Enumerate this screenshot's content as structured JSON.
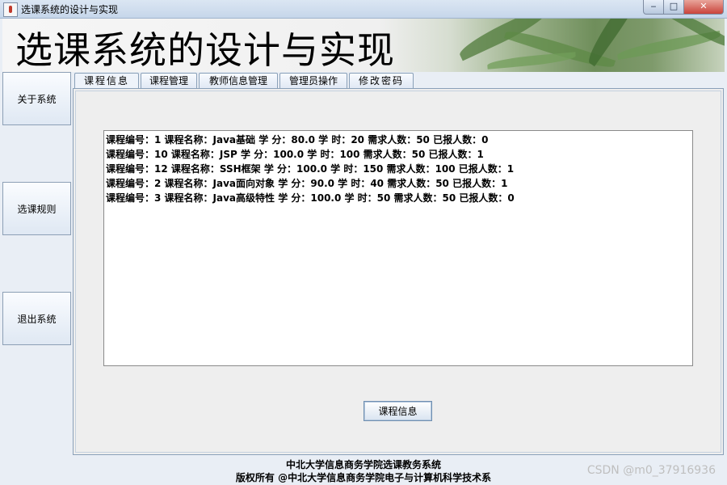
{
  "window": {
    "title": "选课系统的设计与实现",
    "controls": {
      "minimize": "‒",
      "maximize": "□",
      "close": "✕"
    }
  },
  "banner": {
    "title": "选课系统的设计与实现"
  },
  "sidebar": {
    "items": [
      {
        "label": "关于系统"
      },
      {
        "label": "选课规则"
      },
      {
        "label": "退出系统"
      }
    ]
  },
  "tabs": [
    {
      "label": "课程信息",
      "active": true
    },
    {
      "label": "课程管理",
      "active": false
    },
    {
      "label": "教师信息管理",
      "active": false
    },
    {
      "label": "管理员操作",
      "active": false
    },
    {
      "label": "修改密码",
      "active": false
    }
  ],
  "courses": [
    "课程编号：1  课程名称：Java基础  学 分：80.0  学 时：20  需求人数：50  已报人数：0",
    "课程编号：10  课程名称：JSP  学 分：100.0  学 时：100  需求人数：50  已报人数：1",
    "课程编号：12  课程名称：SSH框架  学 分：100.0  学 时：150  需求人数：100  已报人数：1",
    "课程编号：2  课程名称：Java面向对象  学 分：90.0  学 时：40  需求人数：50  已报人数：1",
    "课程编号：3  课程名称：Java高级特性  学 分：100.0  学 时：50  需求人数：50  已报人数：0"
  ],
  "query_button": {
    "label": "课程信息"
  },
  "footer": {
    "line1": "中北大学信息商务学院选课教务系统",
    "line2": "版权所有 @中北大学信息商务学院电子与计算机科学技术系"
  },
  "watermark": "CSDN @m0_37916936"
}
